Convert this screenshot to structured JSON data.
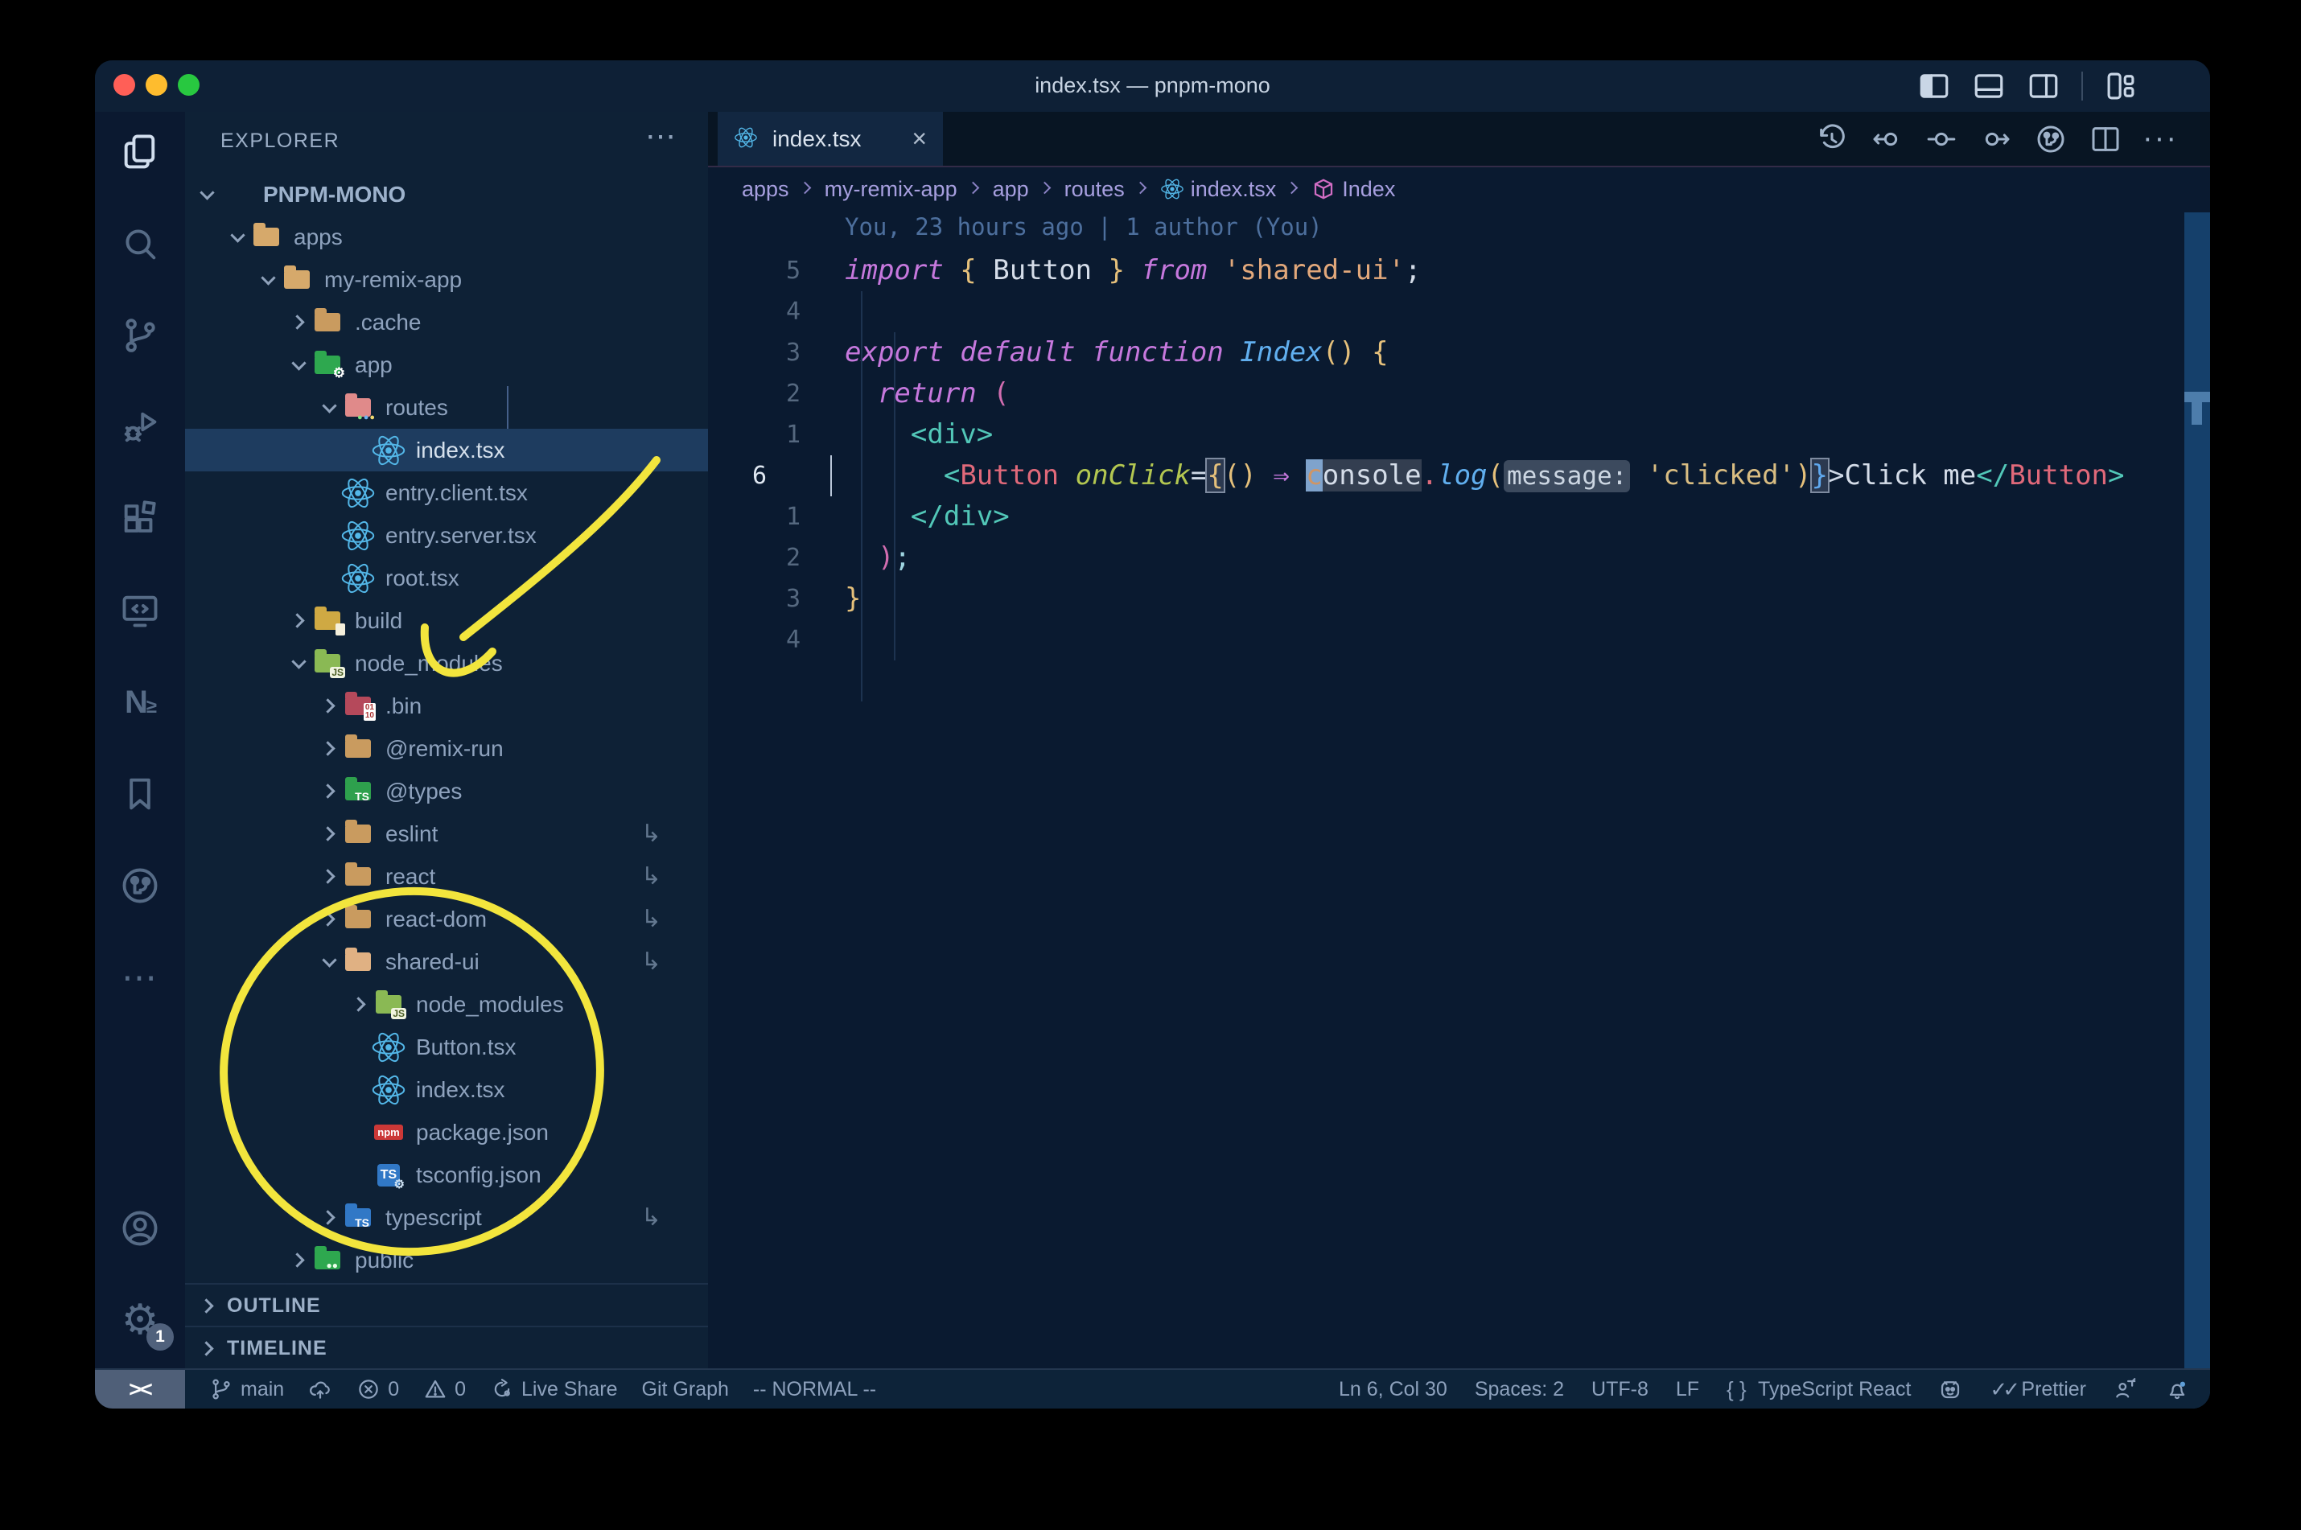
{
  "window": {
    "title": "index.tsx — pnpm-mono",
    "traffic_lights": [
      "close",
      "minimize",
      "zoom"
    ],
    "layout_buttons": [
      "toggle-primary-sidebar",
      "toggle-panel",
      "toggle-secondary-sidebar",
      "customize-layout"
    ]
  },
  "activity_bar": {
    "top": [
      {
        "name": "explorer",
        "active": true
      },
      {
        "name": "search"
      },
      {
        "name": "source-control"
      },
      {
        "name": "run-debug"
      },
      {
        "name": "extensions"
      },
      {
        "name": "remote-explorer"
      },
      {
        "name": "nx-console"
      },
      {
        "name": "bookmarks"
      },
      {
        "name": "git-graph"
      },
      {
        "name": "more-views"
      }
    ],
    "bottom": [
      {
        "name": "account"
      },
      {
        "name": "settings",
        "badge": "1"
      }
    ]
  },
  "sidebar": {
    "header": "EXPLORER",
    "more_icon": "⋯",
    "outline_label": "OUTLINE",
    "timeline_label": "TIMELINE",
    "tree": [
      {
        "label": "PNPM-MONO",
        "depth": 0,
        "chevron": "down",
        "icon": "none",
        "root": true
      },
      {
        "label": "apps",
        "depth": 1,
        "chevron": "down",
        "icon": "folder-open-tan"
      },
      {
        "label": "my-remix-app",
        "depth": 2,
        "chevron": "down",
        "icon": "folder-open-tan"
      },
      {
        "label": ".cache",
        "depth": 3,
        "chevron": "right",
        "icon": "folder-tan"
      },
      {
        "label": "app",
        "depth": 3,
        "chevron": "down",
        "icon": "folder-app"
      },
      {
        "label": "routes",
        "depth": 4,
        "chevron": "down",
        "icon": "folder-routes"
      },
      {
        "label": "index.tsx",
        "depth": 5,
        "chevron": "none",
        "icon": "react",
        "selected": true
      },
      {
        "label": "entry.client.tsx",
        "depth": 4,
        "chevron": "none",
        "icon": "react"
      },
      {
        "label": "entry.server.tsx",
        "depth": 4,
        "chevron": "none",
        "icon": "react"
      },
      {
        "label": "root.tsx",
        "depth": 4,
        "chevron": "none",
        "icon": "react"
      },
      {
        "label": "build",
        "depth": 3,
        "chevron": "right",
        "icon": "folder-build"
      },
      {
        "label": "node_modules",
        "depth": 3,
        "chevron": "down",
        "icon": "folder-node"
      },
      {
        "label": ".bin",
        "depth": 4,
        "chevron": "right",
        "icon": "folder-binary"
      },
      {
        "label": "@remix-run",
        "depth": 4,
        "chevron": "right",
        "icon": "folder-tan"
      },
      {
        "label": "@types",
        "depth": 4,
        "chevron": "right",
        "icon": "folder-types"
      },
      {
        "label": "eslint",
        "depth": 4,
        "chevron": "right",
        "icon": "folder-tan",
        "symlink": true
      },
      {
        "label": "react",
        "depth": 4,
        "chevron": "right",
        "icon": "folder-tan",
        "symlink": true
      },
      {
        "label": "react-dom",
        "depth": 4,
        "chevron": "right",
        "icon": "folder-tan",
        "symlink": true
      },
      {
        "label": "shared-ui",
        "depth": 4,
        "chevron": "down",
        "icon": "folder-open-peach",
        "symlink": true
      },
      {
        "label": "node_modules",
        "depth": 5,
        "chevron": "right",
        "icon": "folder-node"
      },
      {
        "label": "Button.tsx",
        "depth": 5,
        "chevron": "none",
        "icon": "react"
      },
      {
        "label": "index.tsx",
        "depth": 5,
        "chevron": "none",
        "icon": "react"
      },
      {
        "label": "package.json",
        "depth": 5,
        "chevron": "none",
        "icon": "npm"
      },
      {
        "label": "tsconfig.json",
        "depth": 5,
        "chevron": "none",
        "icon": "tsconfig"
      },
      {
        "label": "typescript",
        "depth": 4,
        "chevron": "right",
        "icon": "folder-typescript",
        "symlink": true
      },
      {
        "label": "public",
        "depth": 3,
        "chevron": "right",
        "icon": "folder-public"
      }
    ]
  },
  "editor": {
    "tab": {
      "label": "index.tsx",
      "icon": "react",
      "close_icon": "×"
    },
    "actions": [
      {
        "name": "timeline-history"
      },
      {
        "name": "previous-change"
      },
      {
        "name": "current-change"
      },
      {
        "name": "next-change"
      },
      {
        "name": "git-graph-view"
      },
      {
        "name": "split-editor"
      },
      {
        "name": "more-actions"
      }
    ],
    "breadcrumbs": [
      {
        "label": "apps"
      },
      {
        "label": "my-remix-app"
      },
      {
        "label": "app"
      },
      {
        "label": "routes"
      },
      {
        "label": "index.tsx",
        "icon": "react"
      },
      {
        "label": "Index",
        "icon": "symbol-cube"
      }
    ],
    "blame": "You, 23 hours ago | 1 author (You)",
    "code": {
      "lines": [
        {
          "gutter": "5",
          "tokens": [
            {
              "t": "import ",
              "s": "kw"
            },
            {
              "t": "{ ",
              "s": "bry"
            },
            {
              "t": "Button",
              "s": "var"
            },
            {
              "t": " } ",
              "s": "bry"
            },
            {
              "t": "from ",
              "s": "kw"
            },
            {
              "t": "'shared-ui'",
              "s": "stro"
            },
            {
              "t": ";",
              "s": "txt"
            }
          ]
        },
        {
          "gutter": "4",
          "tokens": []
        },
        {
          "gutter": "3",
          "tokens": [
            {
              "t": "export default ",
              "s": "kw"
            },
            {
              "t": "function ",
              "s": "kw"
            },
            {
              "t": "Index",
              "s": "fnb"
            },
            {
              "t": "()",
              "s": "bry"
            },
            {
              "t": " {",
              "s": "bry"
            }
          ]
        },
        {
          "gutter": "2",
          "tokens": [
            {
              "t": "  ",
              "s": "txt"
            },
            {
              "t": "return ",
              "s": "kw"
            },
            {
              "t": "(",
              "s": "brp"
            }
          ]
        },
        {
          "gutter": "1",
          "tokens": [
            {
              "t": "    ",
              "s": "txt"
            },
            {
              "t": "<div>",
              "s": "tag"
            }
          ]
        },
        {
          "gutter": "6",
          "current": true,
          "tokens": [
            {
              "t": "      ",
              "s": "txt"
            },
            {
              "t": "<",
              "s": "tag"
            },
            {
              "t": "Button",
              "s": "comp"
            },
            {
              "t": " ",
              "s": "txt"
            },
            {
              "t": "onClick",
              "s": "attr"
            },
            {
              "t": "=",
              "s": "op"
            },
            {
              "t": "{",
              "s": "boxy"
            },
            {
              "t": "()",
              "s": "bry"
            },
            {
              "t": " ",
              "s": "txt"
            },
            {
              "t": "⇒",
              "s": "arrow"
            },
            {
              "t": " ",
              "s": "txt"
            },
            {
              "t": "c",
              "s": "cursor"
            },
            {
              "t": "onsole",
              "s": "whl"
            },
            {
              "t": ".",
              "s": "dot"
            },
            {
              "t": "log",
              "s": "fnb"
            },
            {
              "t": "(",
              "s": "bry"
            },
            {
              "t": "message:",
              "s": "inlay"
            },
            {
              "t": " ",
              "s": "txt"
            },
            {
              "t": "'clicked'",
              "s": "strg"
            },
            {
              "t": ")",
              "s": "bry"
            },
            {
              "t": "}",
              "s": "boxb"
            },
            {
              "t": ">",
              "s": "op"
            },
            {
              "t": "Click me",
              "s": "txt"
            },
            {
              "t": "</",
              "s": "tag"
            },
            {
              "t": "Button",
              "s": "comp"
            },
            {
              "t": ">",
              "s": "tag"
            }
          ]
        },
        {
          "gutter": "1",
          "tokens": [
            {
              "t": "    ",
              "s": "txt"
            },
            {
              "t": "</div>",
              "s": "tag"
            }
          ]
        },
        {
          "gutter": "2",
          "tokens": [
            {
              "t": "  ",
              "s": "txt"
            },
            {
              "t": ")",
              "s": "brp"
            },
            {
              "t": ";",
              "s": "semi"
            }
          ]
        },
        {
          "gutter": "3",
          "tokens": [
            {
              "t": "}",
              "s": "bry"
            }
          ]
        },
        {
          "gutter": "4",
          "tokens": []
        }
      ]
    }
  },
  "status_bar": {
    "left": [
      {
        "name": "remote-indicator",
        "icon": "remote",
        "label": "><"
      },
      {
        "name": "git-branch",
        "icon": "branch",
        "label": "main"
      },
      {
        "name": "sync-changes",
        "icon": "cloud-upload",
        "label": ""
      },
      {
        "name": "errors",
        "icon": "error",
        "label": "0"
      },
      {
        "name": "warnings",
        "icon": "warning",
        "label": "0"
      },
      {
        "name": "live-share",
        "icon": "live-share",
        "label": "Live Share"
      },
      {
        "name": "git-graph",
        "label": "Git Graph"
      },
      {
        "name": "vim-mode",
        "label": "-- NORMAL --"
      }
    ],
    "right": [
      {
        "name": "cursor-position",
        "label": "Ln 6, Col 30"
      },
      {
        "name": "indentation",
        "label": "Spaces: 2"
      },
      {
        "name": "encoding",
        "label": "UTF-8"
      },
      {
        "name": "eol",
        "label": "LF"
      },
      {
        "name": "language-mode",
        "icon": "braces",
        "label": "TypeScript React"
      },
      {
        "name": "github",
        "icon": "octoface",
        "label": ""
      },
      {
        "name": "prettier",
        "icon": "double-check",
        "label": "Prettier"
      },
      {
        "name": "feedback",
        "icon": "feedback",
        "label": ""
      },
      {
        "name": "notifications",
        "icon": "bell",
        "label": ""
      }
    ]
  },
  "annotations": {
    "color": "#f2e53d",
    "shapes": [
      "hand-drawn-arrow-to-node-modules",
      "hand-drawn-circle-around-shared-ui"
    ]
  }
}
